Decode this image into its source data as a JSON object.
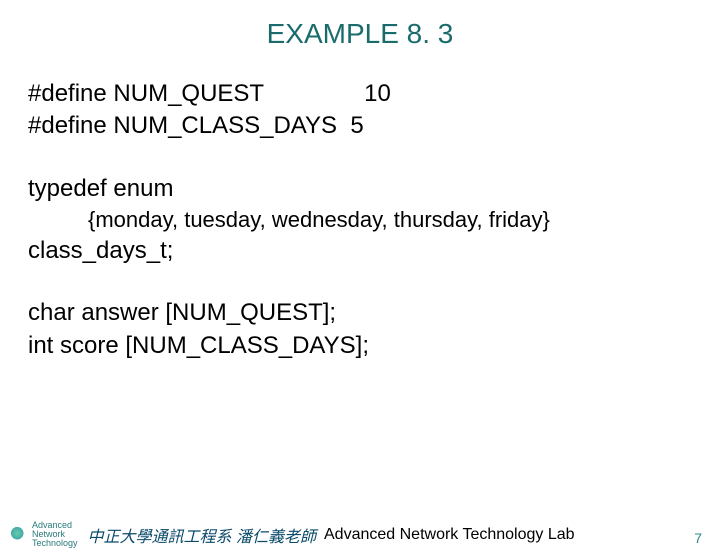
{
  "title": "EXAMPLE 8. 3",
  "lines": {
    "l1": "#define NUM_QUEST               10",
    "l2": "#define NUM_CLASS_DAYS  5",
    "l3": "typedef enum",
    "l4": "{monday, tuesday, wednesday, thursday, friday}",
    "l5": "class_days_t;",
    "l6": "char answer [NUM_QUEST];",
    "l7": "int score [NUM_CLASS_DAYS];"
  },
  "footer": {
    "logo_small": "Advanced\nNetwork\nTechnology",
    "org": "中正大學通訊工程系 潘仁義老師",
    "lab": "Advanced Network Technology Lab",
    "page": "7"
  }
}
